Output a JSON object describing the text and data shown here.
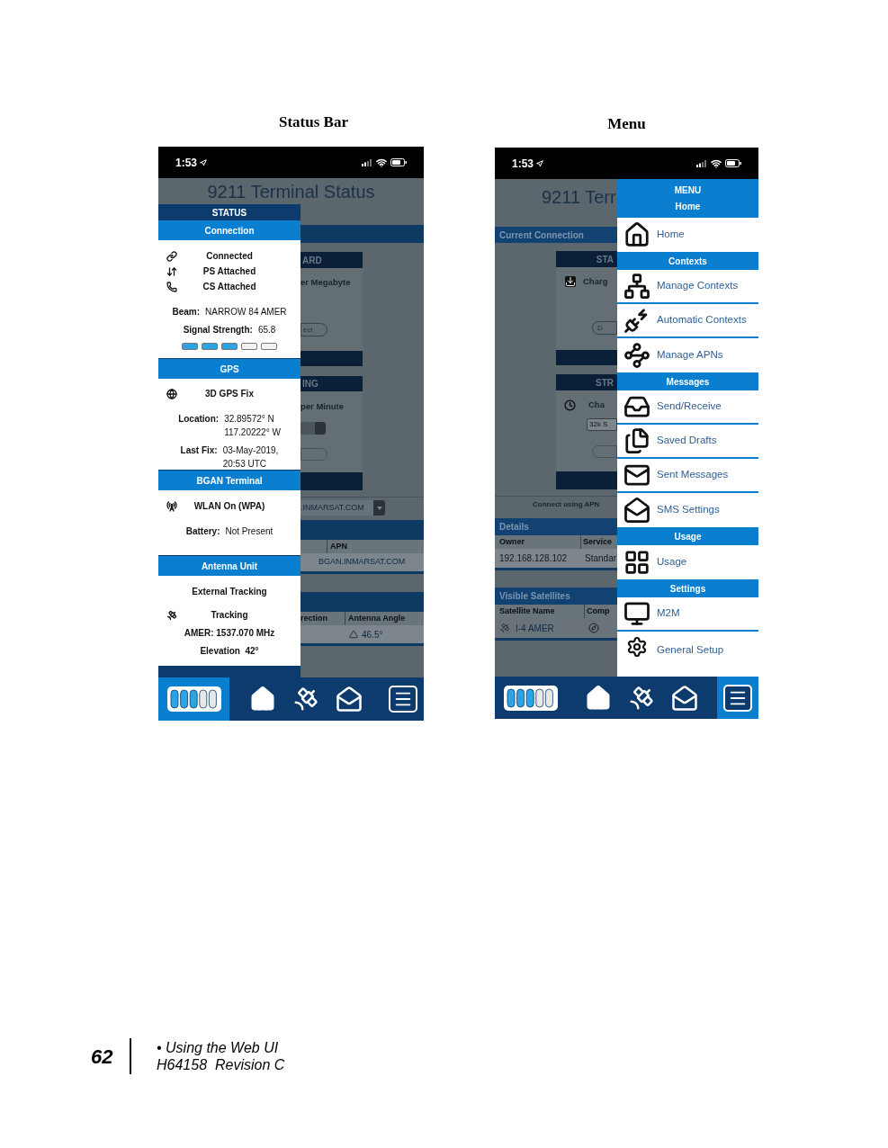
{
  "status_figure": {
    "caption": "Status Bar",
    "time": "1:53",
    "background": {
      "title": "9211 Terminal Status",
      "card_1": {
        "header": "ARD",
        "text": "er Megabyte",
        "button": "ect"
      },
      "card_2": {
        "header": "ING",
        "text": "per Minute"
      },
      "apn_select": ".INMARSAT.COM",
      "apn_table": {
        "columns": [
          "APN"
        ],
        "cell": "BGAN.INMARSAT.COM"
      },
      "antenna_table": {
        "columns": [
          "rection",
          "Antenna Angle"
        ],
        "cell": "46.5°"
      }
    },
    "panel": {
      "title": "STATUS",
      "sections": [
        {
          "title": "Connection",
          "items": [
            {
              "kind": "status",
              "text": "Connected"
            },
            {
              "kind": "status",
              "text": "PS Attached"
            },
            {
              "kind": "status",
              "text": "CS Attached"
            },
            {
              "kind": "field",
              "label": "Beam:",
              "lines": [
                "NARROW 84 AMER"
              ]
            },
            {
              "kind": "field",
              "label": "Signal Strength:",
              "lines": [
                "65.8"
              ]
            },
            {
              "kind": "meter",
              "level": 0.6
            }
          ]
        },
        {
          "title": "GPS",
          "items": [
            {
              "kind": "status",
              "text": "3D GPS Fix"
            },
            {
              "kind": "field",
              "label": "Location:",
              "lines": [
                "32.89572° N",
                "117.20222° W"
              ]
            },
            {
              "kind": "field",
              "label": "Last Fix:",
              "lines": [
                "03-May-2019,",
                "20:53 UTC"
              ]
            }
          ]
        },
        {
          "title": "BGAN Terminal",
          "items": [
            {
              "kind": "status",
              "text": "WLAN On (WPA)"
            },
            {
              "kind": "field",
              "label": "Battery:",
              "lines": [
                "Not Present"
              ]
            }
          ]
        },
        {
          "title": "Antenna Unit",
          "items": [
            {
              "kind": "line",
              "text": "External Tracking"
            },
            {
              "kind": "status",
              "text": "Tracking"
            },
            {
              "kind": "line",
              "text": "AMER: 1537.070 MHz"
            },
            {
              "kind": "line",
              "text": "Elevation  42°"
            }
          ]
        }
      ]
    },
    "nav": [
      {
        "selected": true
      },
      {
        "selected": false
      },
      {
        "selected": false
      },
      {
        "selected": false
      },
      {
        "selected": false
      }
    ]
  },
  "menu_figure": {
    "caption": "Menu",
    "time": "1:53",
    "background": {
      "title": "9211 Terr",
      "connection_bar": "Current Connection",
      "card_1": {
        "header": "STA",
        "text": "Charg",
        "button": "D"
      },
      "card_2": {
        "header": "STR",
        "text": "Cha",
        "select": "32k S"
      },
      "apn_label": "Connect using APN",
      "details": {
        "title": "Details",
        "columns": [
          "Owner",
          "Service"
        ],
        "row": [
          "192.168.128.102",
          "Standar"
        ]
      },
      "satellites": {
        "title": "Visible Satellites",
        "columns": [
          "Satellite Name",
          "Comp"
        ],
        "row": [
          "I-4 AMER"
        ]
      }
    },
    "menu": {
      "title": "MENU",
      "subtitle": "Home",
      "entries": [
        {
          "kind": "item",
          "label": "Home"
        },
        {
          "kind": "header",
          "label": "Contexts"
        },
        {
          "kind": "item",
          "label": "Manage Contexts"
        },
        {
          "kind": "item",
          "label": "Automatic Contexts"
        },
        {
          "kind": "item",
          "label": "Manage APNs"
        },
        {
          "kind": "header",
          "label": "Messages"
        },
        {
          "kind": "item",
          "label": "Send/Receive"
        },
        {
          "kind": "item",
          "label": "Saved Drafts"
        },
        {
          "kind": "item",
          "label": "Sent Messages"
        },
        {
          "kind": "item",
          "label": "SMS Settings"
        },
        {
          "kind": "header",
          "label": "Usage"
        },
        {
          "kind": "item",
          "label": "Usage"
        },
        {
          "kind": "header",
          "label": "Settings"
        },
        {
          "kind": "item",
          "label": "M2M"
        },
        {
          "kind": "item",
          "label": "General Setup"
        }
      ]
    },
    "nav": [
      {
        "selected": false
      },
      {
        "selected": false
      },
      {
        "selected": false
      },
      {
        "selected": false
      },
      {
        "selected": true
      }
    ]
  },
  "footer": {
    "page_number": "62",
    "lines": [
      "• Using the Web UI",
      "H64158  Revision C"
    ]
  }
}
